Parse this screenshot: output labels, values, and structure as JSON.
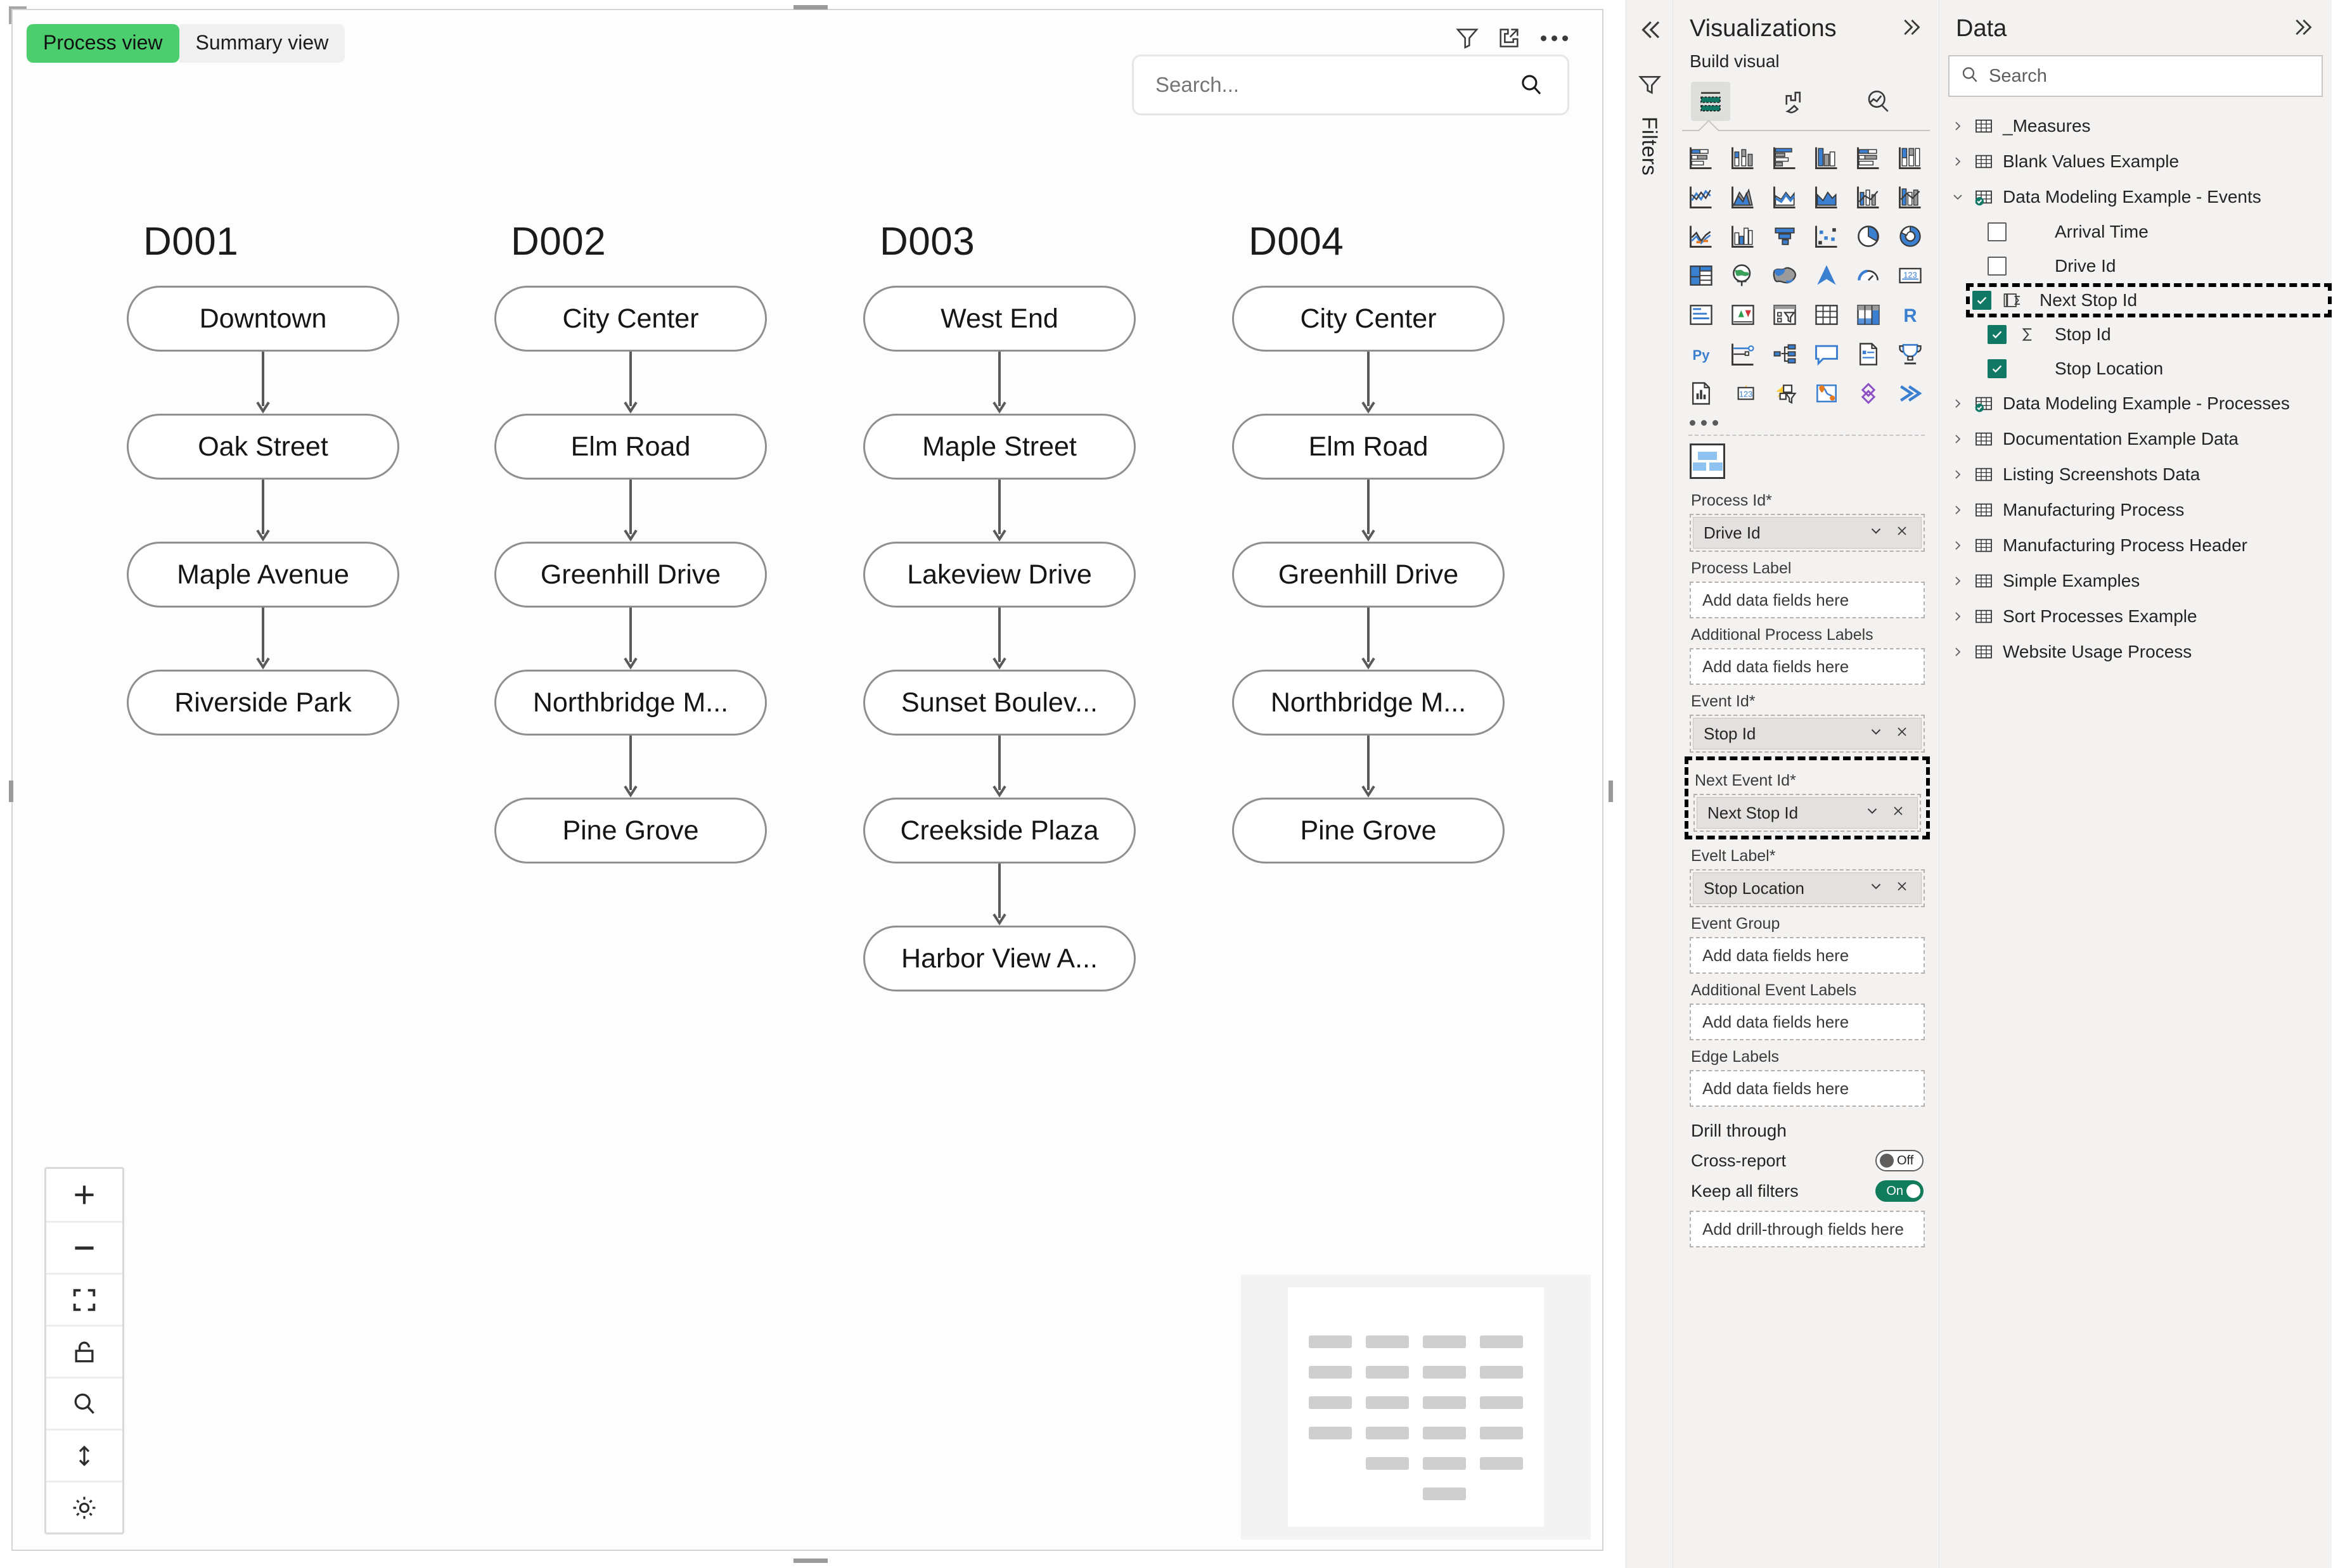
{
  "visual": {
    "tabs": [
      {
        "label": "Process view",
        "active": true
      },
      {
        "label": "Summary view",
        "active": false
      }
    ],
    "header_icons": [
      {
        "name": "filter-icon",
        "title": "Filters"
      },
      {
        "name": "focus-mode-icon",
        "title": "Focus mode"
      },
      {
        "name": "more-options-icon",
        "title": "More options"
      }
    ],
    "search": {
      "placeholder": "Search...",
      "value": "",
      "icon": "search-icon"
    },
    "controls": [
      {
        "name": "zoom-in",
        "glyph": "+"
      },
      {
        "name": "zoom-out",
        "glyph": "–"
      },
      {
        "name": "fit-to-screen",
        "glyph": "fit"
      },
      {
        "name": "lock",
        "glyph": "lock"
      },
      {
        "name": "search-zoom",
        "glyph": "search"
      },
      {
        "name": "vertical-resize",
        "glyph": "updown"
      },
      {
        "name": "brightness",
        "glyph": "sun"
      }
    ]
  },
  "chart_data": {
    "type": "diagram",
    "title": "Process view",
    "columns": [
      {
        "id": "D001",
        "nodes": [
          "Downtown",
          "Oak Street",
          "Maple Avenue",
          "Riverside Park"
        ]
      },
      {
        "id": "D002",
        "nodes": [
          "City Center",
          "Elm Road",
          "Greenhill Drive",
          "Northbridge M...",
          "Pine Grove"
        ]
      },
      {
        "id": "D003",
        "nodes": [
          "West End",
          "Maple Street",
          "Lakeview Drive",
          "Sunset Boulev...",
          "Creekside Plaza",
          "Harbor View A..."
        ]
      },
      {
        "id": "D004",
        "nodes": [
          "City Center",
          "Elm Road",
          "Greenhill Drive",
          "Northbridge M...",
          "Pine Grove"
        ]
      }
    ]
  },
  "filters_rail": {
    "collapse_icon": "chevron-double-left-icon",
    "funnel_icon": "funnel-icon",
    "label": "Filters"
  },
  "visualizations": {
    "title": "Visualizations",
    "expand_icon": "chevron-double-right-icon",
    "build_label": "Build visual",
    "tabs": [
      {
        "name": "fields-tab",
        "selected": true
      },
      {
        "name": "format-tab",
        "selected": false
      },
      {
        "name": "analytics-tab",
        "selected": false
      }
    ],
    "gallery": [
      [
        "stacked-bar-chart",
        "stacked-column-chart",
        "clustered-bar-chart",
        "clustered-column-chart",
        "100-stacked-bar-chart",
        "100-stacked-column-chart"
      ],
      [
        "line-chart",
        "area-chart",
        "stacked-area-chart",
        "line-stacked-column-chart",
        "line-clustered-column-chart",
        "ribbon-chart"
      ],
      [
        "waterfall-chart",
        "funnel-chart-alt",
        "funnel-chart",
        "scatter-chart",
        "pie-chart",
        "donut-chart"
      ],
      [
        "treemap",
        "map",
        "filled-map",
        "azure-map",
        "gauge-chart",
        "card"
      ],
      [
        "multi-row-card",
        "kpi",
        "slicer",
        "table",
        "matrix",
        "r-script-visual"
      ],
      [
        "python-visual",
        "key-influencers",
        "decomposition-tree",
        "q-and-a",
        "narrative",
        "scorecard"
      ],
      [
        "paginated-report",
        "power-apps",
        "power-automate",
        "arcgis-map",
        "azure-ml",
        "power-bi-flow"
      ]
    ],
    "gallery_more": "...",
    "custom_visual_icon": "process-mining-custom-visual",
    "wells": [
      {
        "label": "Process Id*",
        "field": "Drive Id",
        "placeholder": null,
        "highlight": false
      },
      {
        "label": "Process Label",
        "field": null,
        "placeholder": "Add data fields here",
        "highlight": false
      },
      {
        "label": "Additional Process Labels",
        "field": null,
        "placeholder": "Add data fields here",
        "highlight": false
      },
      {
        "label": "Event Id*",
        "field": "Stop Id",
        "placeholder": null,
        "highlight": false
      },
      {
        "label": "Next Event Id*",
        "field": "Next Stop Id",
        "placeholder": null,
        "highlight": true
      },
      {
        "label": "Evelt Label*",
        "field": "Stop Location",
        "placeholder": null,
        "highlight": false
      },
      {
        "label": "Event Group",
        "field": null,
        "placeholder": "Add data fields here",
        "highlight": false
      },
      {
        "label": "Additional Event Labels",
        "field": null,
        "placeholder": "Add data fields here",
        "highlight": false
      },
      {
        "label": "Edge Labels",
        "field": null,
        "placeholder": "Add data fields here",
        "highlight": false
      }
    ],
    "drill_through": {
      "title": "Drill through",
      "cross_report": {
        "label": "Cross-report",
        "state": "Off",
        "on": false
      },
      "keep_all_filters": {
        "label": "Keep all filters",
        "state": "On",
        "on": true
      },
      "add_fields_placeholder": "Add drill-through fields here"
    }
  },
  "data": {
    "title": "Data",
    "expand_icon": "chevron-double-right-icon",
    "search": {
      "placeholder": "Search",
      "value": "",
      "icon": "search-icon"
    },
    "tree": [
      {
        "type": "table",
        "label": "_Measures",
        "expanded": false,
        "badge": false
      },
      {
        "type": "table",
        "label": "Blank Values Example",
        "expanded": false,
        "badge": false
      },
      {
        "type": "table",
        "label": "Data Modeling Example - Events",
        "expanded": true,
        "badge": true
      },
      {
        "type": "field",
        "label": "Arrival Time",
        "checked": false,
        "icon": "none",
        "highlight": false
      },
      {
        "type": "field",
        "label": "Drive Id",
        "checked": false,
        "icon": "none",
        "highlight": false
      },
      {
        "type": "field",
        "label": "Next Stop Id",
        "checked": true,
        "icon": "measure-group",
        "highlight": true
      },
      {
        "type": "field",
        "label": "Stop Id",
        "checked": true,
        "icon": "sigma",
        "highlight": false
      },
      {
        "type": "field",
        "label": "Stop Location",
        "checked": true,
        "icon": "none",
        "highlight": false
      },
      {
        "type": "table",
        "label": "Data Modeling Example - Processes",
        "expanded": false,
        "badge": true
      },
      {
        "type": "table",
        "label": "Documentation Example Data",
        "expanded": false,
        "badge": false
      },
      {
        "type": "table",
        "label": "Listing Screenshots Data",
        "expanded": false,
        "badge": false
      },
      {
        "type": "table",
        "label": "Manufacturing Process",
        "expanded": false,
        "badge": false
      },
      {
        "type": "table",
        "label": "Manufacturing Process Header",
        "expanded": false,
        "badge": false
      },
      {
        "type": "table",
        "label": "Simple Examples",
        "expanded": false,
        "badge": false
      },
      {
        "type": "table",
        "label": "Sort Processes Example",
        "expanded": false,
        "badge": false
      },
      {
        "type": "table",
        "label": "Website Usage Process",
        "expanded": false,
        "badge": false
      }
    ]
  },
  "colors": {
    "accent_green": "#4cce6f",
    "teal_checked": "#117865",
    "toggle_on": "#107c5b",
    "pane_bg": "#f3f2f1",
    "node_border": "#8f8f8f"
  }
}
